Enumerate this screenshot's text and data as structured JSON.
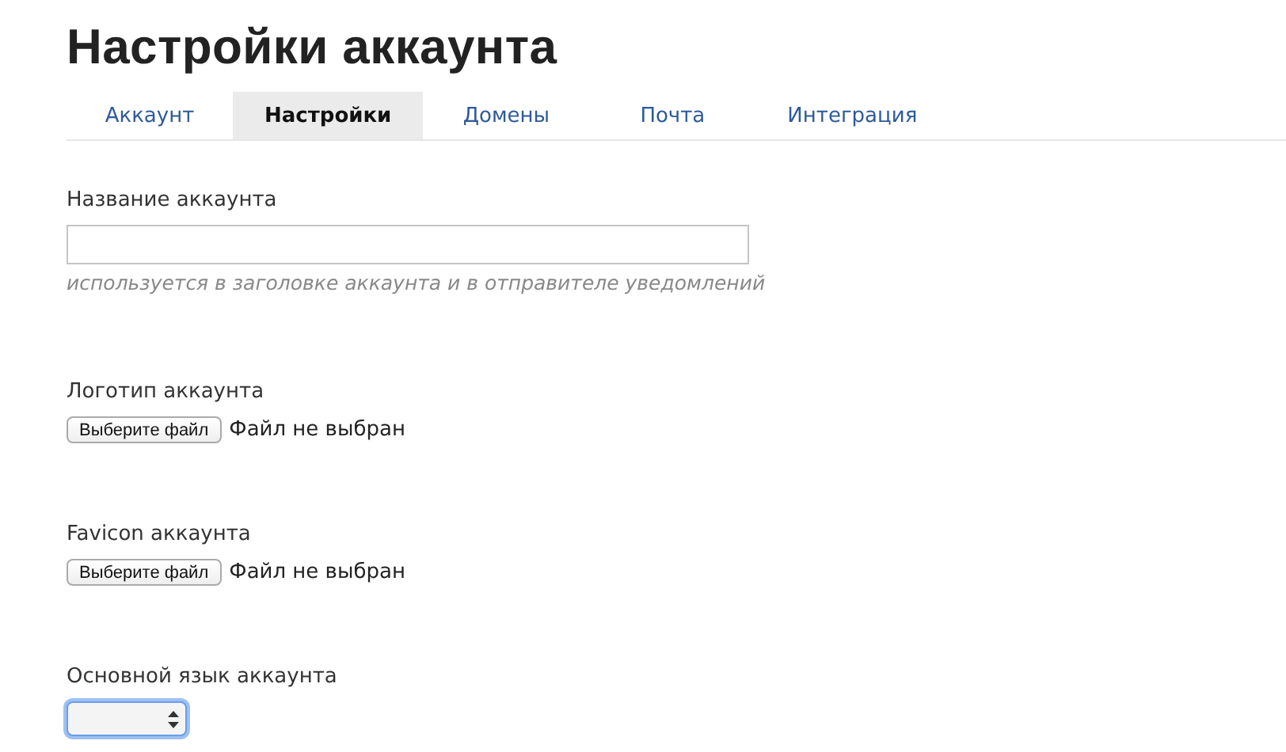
{
  "title": "Настройки аккаунта",
  "tabs": [
    {
      "label": "Аккаунт",
      "selected": false
    },
    {
      "label": "Настройки",
      "selected": true
    },
    {
      "label": "Домены",
      "selected": false
    },
    {
      "label": "Почта",
      "selected": false
    },
    {
      "label": "Интеграция",
      "selected": false
    }
  ],
  "fields": [
    {
      "kind": "text",
      "label": "Название аккаунта",
      "hint": "используется в заголовке аккаунта и в отправителе уведомлений"
    },
    {
      "kind": "file",
      "label": "Логотип аккаунта",
      "button": "Выберите файл",
      "status": "Файл не выбран"
    },
    {
      "kind": "file",
      "label": "Favicon аккаунта",
      "button": "Выберите файл",
      "status": "Файл не выбран"
    },
    {
      "kind": "select",
      "label": "Основной язык аккаунта",
      "focused": true
    }
  ]
}
